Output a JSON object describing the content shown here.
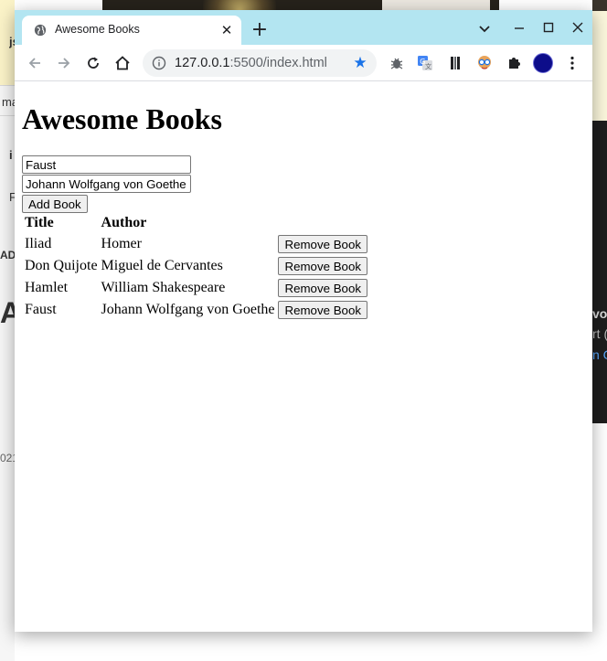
{
  "browser": {
    "tab_title": "Awesome Books",
    "url_host": "127.0.0.1",
    "url_rest": ":5500/index.html",
    "colors": {
      "titlebar": "#b3e5f1",
      "star": "#1a73e8",
      "avatar": "#0d0d8a"
    },
    "icons": [
      "globe-icon",
      "close-icon",
      "plus-icon",
      "chevron-down-icon",
      "minimize-icon",
      "maximize-icon",
      "close-window-icon",
      "back-icon",
      "forward-icon",
      "reload-icon",
      "home-icon",
      "info-icon",
      "star-icon",
      "bug-extension-icon",
      "translate-extension-icon",
      "bookmark-extension-icon",
      "glasses-extension-icon",
      "puzzle-extension-icon",
      "profile-avatar",
      "more-menu-icon"
    ]
  },
  "page": {
    "heading": "Awesome Books",
    "form": {
      "title_value": "Faust",
      "author_value": "Johann Wolfgang von Goethe",
      "add_label": "Add Book"
    },
    "table": {
      "headers": [
        "Title",
        "Author"
      ],
      "remove_label": "Remove Book",
      "rows": [
        {
          "title": "Iliad",
          "author": "Homer"
        },
        {
          "title": "Don Quijote",
          "author": "Miguel de Cervantes"
        },
        {
          "title": "Hamlet",
          "author": "William Shakespeare"
        },
        {
          "title": "Faust",
          "author": "Johann Wolfgang von Goethe"
        }
      ]
    }
  },
  "background": {
    "left_fragments": [
      "js",
      "ma",
      "i",
      "F",
      "AD",
      "A",
      "021"
    ],
    "right_fragments": [
      "vo",
      "rt (",
      "n G"
    ]
  }
}
